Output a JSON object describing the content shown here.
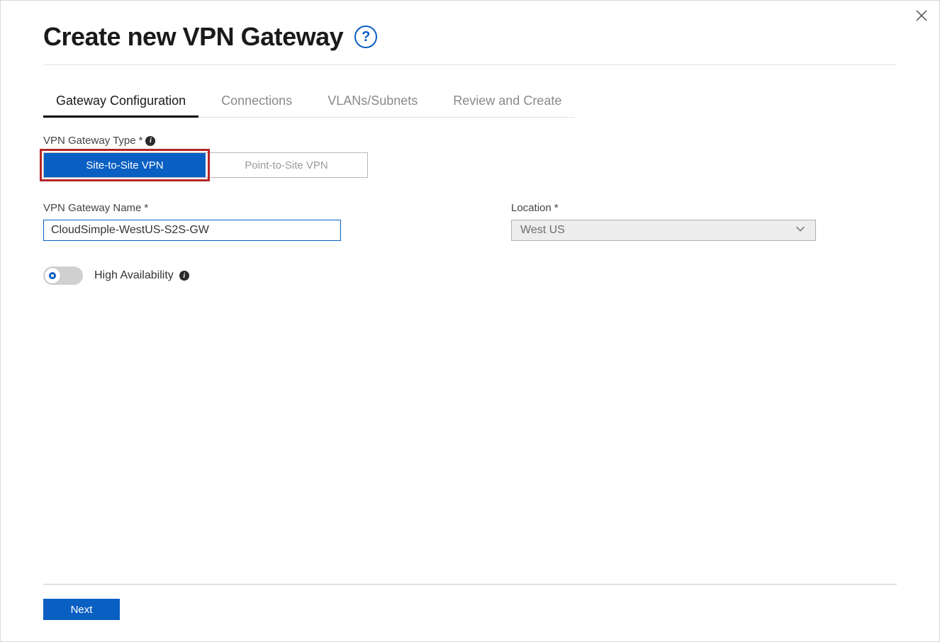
{
  "header": {
    "title": "Create new VPN Gateway"
  },
  "tabs": [
    {
      "label": "Gateway Configuration",
      "active": true
    },
    {
      "label": "Connections",
      "active": false
    },
    {
      "label": "VLANs/Subnets",
      "active": false
    },
    {
      "label": "Review and Create",
      "active": false
    }
  ],
  "form": {
    "gateway_type": {
      "label": "VPN Gateway Type",
      "required_marker": "*",
      "options": {
        "site_to_site": "Site-to-Site VPN",
        "point_to_site": "Point-to-Site VPN"
      },
      "selected": "site_to_site"
    },
    "gateway_name": {
      "label": "VPN Gateway Name",
      "required_marker": "*",
      "value": "CloudSimple-WestUS-S2S-GW"
    },
    "location": {
      "label": "Location",
      "required_marker": "*",
      "value": "West US"
    },
    "high_availability": {
      "label": "High Availability",
      "enabled": false
    }
  },
  "footer": {
    "next_label": "Next"
  },
  "icons": {
    "help": "?",
    "info": "i"
  }
}
